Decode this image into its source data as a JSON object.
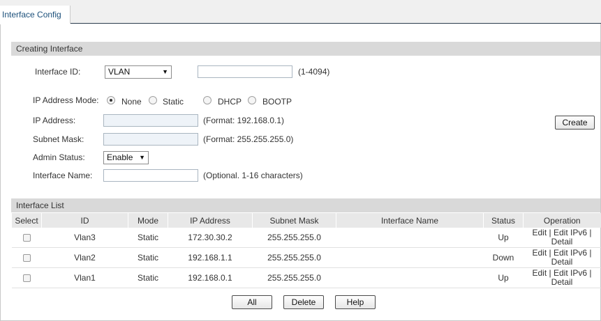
{
  "tabs": [
    {
      "label": "Interface Config"
    }
  ],
  "creating": {
    "header": "Creating Interface",
    "interface_id_label": "Interface ID:",
    "interface_type": "VLAN",
    "interface_id_value": "",
    "interface_id_hint": "(1-4094)",
    "ip_mode_label": "IP Address Mode:",
    "ip_modes": [
      "None",
      "Static",
      "DHCP",
      "BOOTP"
    ],
    "ip_mode_selected": "None",
    "ip_address_label": "IP Address:",
    "ip_address_hint": "(Format: 192.168.0.1)",
    "subnet_mask_label": "Subnet Mask:",
    "subnet_mask_hint": "(Format: 255.255.255.0)",
    "admin_status_label": "Admin Status:",
    "admin_status_value": "Enable",
    "interface_name_label": "Interface Name:",
    "interface_name_hint": "(Optional. 1-16 characters)",
    "create_label": "Create"
  },
  "list": {
    "header": "Interface List",
    "columns": [
      "Select",
      "ID",
      "Mode",
      "IP Address",
      "Subnet Mask",
      "Interface Name",
      "Status",
      "Operation"
    ],
    "rows": [
      {
        "id": "Vlan3",
        "mode": "Static",
        "ip": "172.30.30.2",
        "mask": "255.255.255.0",
        "name": "",
        "status": "Up"
      },
      {
        "id": "Vlan2",
        "mode": "Static",
        "ip": "192.168.1.1",
        "mask": "255.255.255.0",
        "name": "",
        "status": "Down"
      },
      {
        "id": "Vlan1",
        "mode": "Static",
        "ip": "192.168.0.1",
        "mask": "255.255.255.0",
        "name": "",
        "status": "Up"
      }
    ],
    "op_edit": "Edit",
    "op_edit_ipv6": "Edit IPv6",
    "op_detail": "Detail",
    "op_sep": "|"
  },
  "footer_buttons": {
    "all": "All",
    "delete": "Delete",
    "help": "Help"
  },
  "colors": {
    "section_header": "#d9d9d9",
    "link": "#2f6fb0",
    "tab_text": "#1b4f7a"
  },
  "icons": {
    "dropdown": "chevron-down-icon"
  }
}
